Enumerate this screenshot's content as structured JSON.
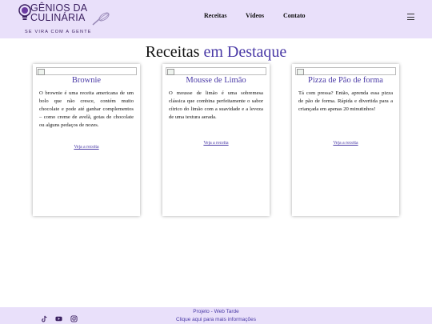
{
  "header": {
    "logo_title_line1": "GÊNIOS DA",
    "logo_title_line2": "CULINÁRIA",
    "logo_tagline": "SE VIRA COM A GENTE",
    "nav": [
      "Receitas",
      "Vídeos",
      "Contato"
    ],
    "menu_icon": "hamburger-menu-icon"
  },
  "section": {
    "title_main": "Receitas",
    "title_accent": "em Destaque"
  },
  "cards": [
    {
      "title": "Brownie",
      "text": "O brownie é uma receita americana de um bolo que não cresce, contém muito chocolate e pode até ganhar complementos – como creme de avelã, gotas de chocolate ou alguns pedaços de nozes.",
      "link": "Veja a receita"
    },
    {
      "title": "Mousse de Limão",
      "text": "O mousse de limão é uma sobremesa clássica que combina perfeitamente o sabor cítrico do limão com a suavidade e a leveza de uma textura aerada.",
      "link": "Veja a receita"
    },
    {
      "title": "Pizza de Pão de forma",
      "text": "Tá com pressa? Então, aprenda essa pizza de pão de forma. Rápida e divertida para a criançada em apenas 20 minutinhos!",
      "link": "Veja a receita"
    }
  ],
  "footer": {
    "line1": "Projeto - Web Tarde",
    "line2": "Clique aqui para mais informações",
    "social_icons": [
      "tiktok-icon",
      "youtube-icon",
      "instagram-icon"
    ]
  },
  "colors": {
    "header_bg": "#e9e0fa",
    "accent": "#4a3aa6",
    "logo": "#3b2060"
  }
}
